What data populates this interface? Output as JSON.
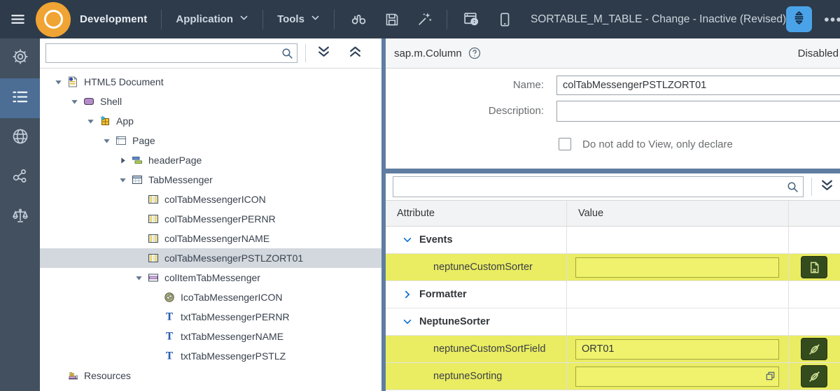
{
  "topbar": {
    "product_label": "Development",
    "menu_application": "Application",
    "menu_tools": "Tools",
    "tool_icons": [
      "binoculars",
      "save",
      "magic-wand",
      "preview-browser",
      "preview-mobile"
    ],
    "document_title": "SORTABLE_M_TABLE - Change - Inactive (Revised)",
    "accent_button_icon": "sort",
    "more_options_icon": "ellipsis",
    "colors": {
      "bar_bg": "#2e3b4a",
      "accent_button": "#4aa3e8",
      "logo": "#f0a433"
    }
  },
  "sidebar": {
    "items": [
      {
        "icon": "gear",
        "selected": false
      },
      {
        "icon": "outline-list",
        "selected": true
      },
      {
        "icon": "globe",
        "selected": false
      },
      {
        "icon": "share",
        "selected": false
      },
      {
        "icon": "scale",
        "selected": false
      }
    ],
    "colors": {
      "bg": "#42505f",
      "selected_bg": "#4c6d94"
    }
  },
  "tree_panel": {
    "search_value": "",
    "toolbar_icons": [
      "search",
      "expand-all",
      "collapse-all"
    ],
    "items": [
      {
        "label": "HTML5 Document",
        "level": 0,
        "state": "expanded",
        "icon": "html5-document",
        "selected": false
      },
      {
        "label": "Shell",
        "level": 1,
        "state": "expanded",
        "icon": "shell",
        "selected": false
      },
      {
        "label": "App",
        "level": 2,
        "state": "expanded",
        "icon": "app",
        "selected": false
      },
      {
        "label": "Page",
        "level": 3,
        "state": "expanded",
        "icon": "page",
        "selected": false
      },
      {
        "label": "headerPage",
        "level": 4,
        "state": "collapsed",
        "icon": "header-bars",
        "selected": false
      },
      {
        "label": "TabMessenger",
        "level": 4,
        "state": "expanded",
        "icon": "table",
        "selected": false
      },
      {
        "label": "colTabMessengerICON",
        "level": 5,
        "state": "leaf",
        "icon": "column",
        "selected": false
      },
      {
        "label": "colTabMessengerPERNR",
        "level": 5,
        "state": "leaf",
        "icon": "column",
        "selected": false
      },
      {
        "label": "colTabMessengerNAME",
        "level": 5,
        "state": "leaf",
        "icon": "column",
        "selected": false
      },
      {
        "label": "colTabMessengerPSTLZORT01",
        "level": 5,
        "state": "leaf",
        "icon": "column",
        "selected": true
      },
      {
        "label": "colItemTabMessenger",
        "level": 5,
        "state": "expanded",
        "icon": "row-item",
        "selected": false
      },
      {
        "label": "IcoTabMessengerICON",
        "level": 6,
        "state": "leaf",
        "icon": "icon-circle",
        "selected": false
      },
      {
        "label": "txtTabMessengerPERNR",
        "level": 6,
        "state": "leaf",
        "icon": "text",
        "selected": false
      },
      {
        "label": "txtTabMessengerNAME",
        "level": 6,
        "state": "leaf",
        "icon": "text",
        "selected": false
      },
      {
        "label": "txtTabMessengerPSTLZ",
        "level": 6,
        "state": "leaf",
        "icon": "text",
        "selected": false
      },
      {
        "label": "Resources",
        "level": 0,
        "state": "leaf",
        "icon": "resources",
        "selected": false
      }
    ]
  },
  "inspector": {
    "header": {
      "control_name": "sap.m.Column",
      "help_icon": "question-mark",
      "status_label": "Disabled"
    },
    "form": {
      "name_label": "Name:",
      "name_value": "colTabMessengerPSTLZORT01",
      "description_label": "Description:",
      "description_value": "",
      "declare_checkbox_label": "Do not add to View, only declare",
      "declare_checkbox_checked": false
    },
    "attributes": {
      "search_value": "",
      "columns": [
        "Attribute",
        "Value"
      ],
      "highlight_color": "#eaec62",
      "action_button_color": "#344b1d",
      "rows": [
        {
          "kind": "group",
          "label": "Events",
          "state": "expanded",
          "highlight": false
        },
        {
          "kind": "attribute",
          "label": "neptuneCustomSorter",
          "value": "",
          "highlight": true,
          "has_input": true,
          "value_help": false,
          "action": "script-editor"
        },
        {
          "kind": "group",
          "label": "Formatter",
          "state": "collapsed",
          "highlight": false
        },
        {
          "kind": "group",
          "label": "NeptuneSorter",
          "state": "expanded",
          "highlight": false
        },
        {
          "kind": "attribute",
          "label": "neptuneCustomSortField",
          "value": "ORT01",
          "highlight": true,
          "has_input": true,
          "value_help": false,
          "action": "unbind"
        },
        {
          "kind": "attribute",
          "label": "neptuneSorting",
          "value": "",
          "highlight": true,
          "has_input": true,
          "value_help": true,
          "action": "unbind"
        }
      ]
    }
  }
}
